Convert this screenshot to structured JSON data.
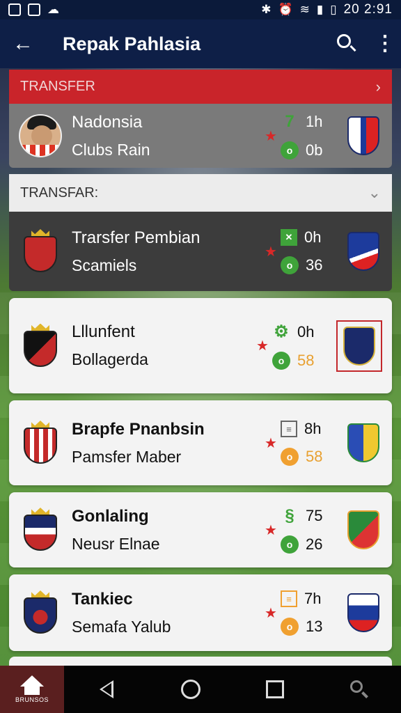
{
  "status_bar": {
    "time": "20 2:91",
    "icons": [
      "notification-icon",
      "image-icon",
      "cloud-icon",
      "bluetooth-icon",
      "alarm-icon",
      "wifi-icon",
      "signal-icon",
      "battery-icon"
    ]
  },
  "app_bar": {
    "title": "Repak Pahlasia"
  },
  "sections": [
    {
      "label": "TRANSFER",
      "color": "#c9242a"
    },
    {
      "label": "TRANSFAR:",
      "color": "#ececec"
    }
  ],
  "rows": [
    {
      "title": "Nadonsia",
      "subtitle": "Clubs Rain",
      "stat1": "1h",
      "stat2": "0b",
      "theme": "gray"
    },
    {
      "title": "Trarsfer Pembian",
      "subtitle": "Scamiels",
      "stat1": "0h",
      "stat2": "36",
      "theme": "dark"
    },
    {
      "title": "Lllunfent",
      "subtitle": "Bollagerda",
      "stat1": "0h",
      "stat2": "58",
      "theme": "card"
    },
    {
      "title": "Brapfe Pnanbsin",
      "subtitle": "Pamsfer Maber",
      "stat1": "8h",
      "stat2": "58",
      "theme": "card"
    },
    {
      "title": "Gonlaling",
      "subtitle": "Neusr Elnae",
      "stat1": "75",
      "stat2": "26",
      "theme": "card"
    },
    {
      "title": "Tankiec",
      "subtitle": "Semafa Yalub",
      "stat1": "7h",
      "stat2": "13",
      "theme": "card"
    }
  ],
  "bottom_nav": {
    "home_label": "BRUNSOS"
  },
  "colors": {
    "app_bar": "#0e1f47",
    "accent_red": "#c9242a",
    "green": "#3fa33a",
    "orange": "#f0a030"
  }
}
